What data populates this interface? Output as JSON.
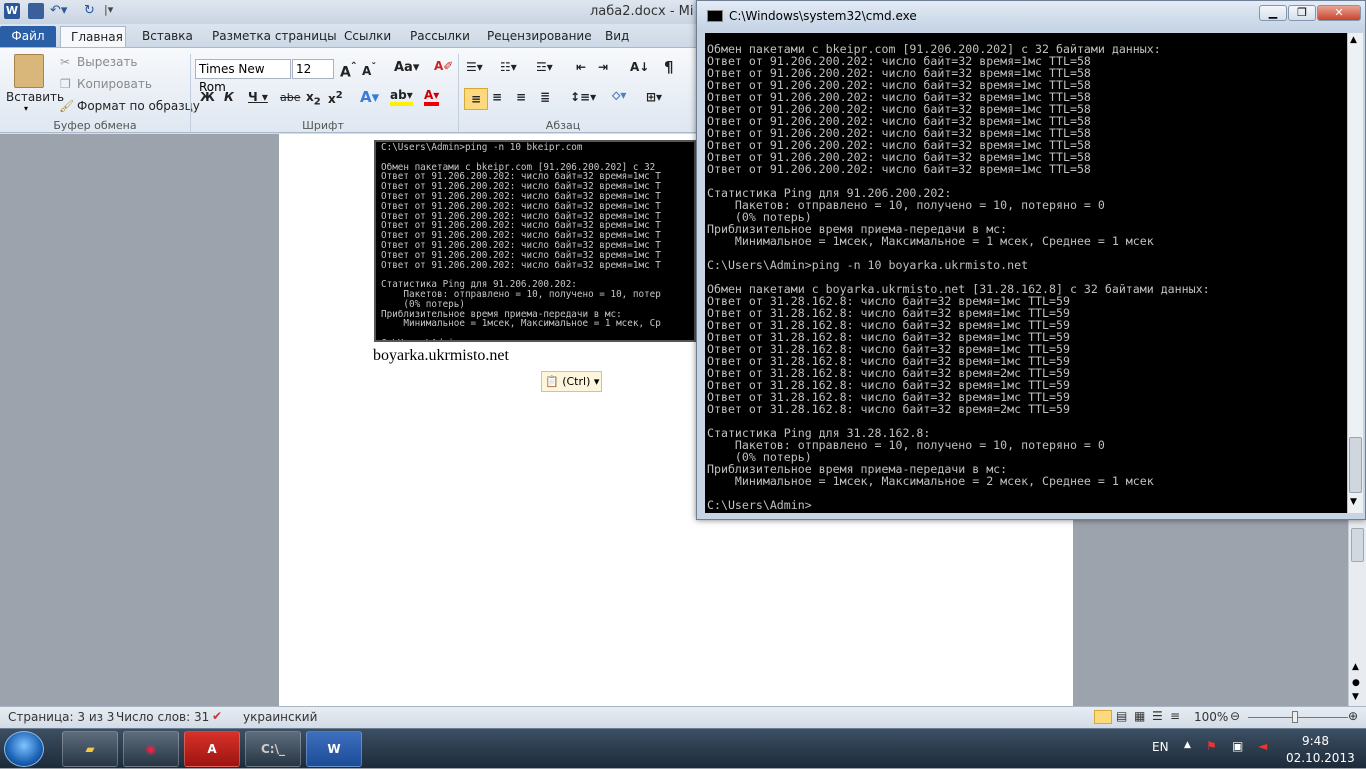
{
  "word": {
    "title": "лаба2.docx - Mi",
    "tabs": [
      "Файл",
      "Главная",
      "Вставка",
      "Разметка страницы",
      "Ссылки",
      "Рассылки",
      "Рецензирование",
      "Вид"
    ],
    "clipboard": {
      "paste": "Вставить",
      "cut": "Вырезать",
      "copy": "Копировать",
      "format": "Формат по образцу",
      "group": "Буфер обмена"
    },
    "font": {
      "name": "Times New Rom",
      "size": "12",
      "group": "Шрифт"
    },
    "paragraph": {
      "group": "Абзац"
    },
    "doc_text": "boyarka.ukrmisto.net",
    "paste_options": "(Ctrl)",
    "embedded_console": [
      "C:\\Users\\Admin>ping -n 10 bkeipr.com",
      "",
      "Обмен пакетами с bkeipr.com [91.206.200.202] с 32",
      "Ответ от 91.206.200.202: число байт=32 время=1мс T",
      "Ответ от 91.206.200.202: число байт=32 время=1мс T",
      "Ответ от 91.206.200.202: число байт=32 время=1мс T",
      "Ответ от 91.206.200.202: число байт=32 время=1мс T",
      "Ответ от 91.206.200.202: число байт=32 время=1мс T",
      "Ответ от 91.206.200.202: число байт=32 время=1мс T",
      "Ответ от 91.206.200.202: число байт=32 время=1мс T",
      "Ответ от 91.206.200.202: число байт=32 время=1мс T",
      "Ответ от 91.206.200.202: число байт=32 время=1мс T",
      "Ответ от 91.206.200.202: число байт=32 время=1мс T",
      "",
      "Статистика Ping для 91.206.200.202:",
      "    Пакетов: отправлено = 10, получено = 10, потер",
      "    (0% потерь)",
      "Приблизительное время приема-передачи в мс:",
      "    Минимальное = 1мсек, Максимальное = 1 мсек, Ср",
      "",
      "C:\\Users\\Admin>"
    ],
    "status": {
      "page": "Страница: 3 из 3",
      "words": "Число слов: 31",
      "lang": "украинский",
      "zoom": "100%"
    }
  },
  "cmd": {
    "title": "C:\\Windows\\system32\\cmd.exe",
    "lines": [
      "Обмен пакетами с bkeipr.com [91.206.200.202] с 32 байтами данных:",
      "Ответ от 91.206.200.202: число байт=32 время=1мс TTL=58",
      "Ответ от 91.206.200.202: число байт=32 время=1мс TTL=58",
      "Ответ от 91.206.200.202: число байт=32 время=1мс TTL=58",
      "Ответ от 91.206.200.202: число байт=32 время=1мс TTL=58",
      "Ответ от 91.206.200.202: число байт=32 время=1мс TTL=58",
      "Ответ от 91.206.200.202: число байт=32 время=1мс TTL=58",
      "Ответ от 91.206.200.202: число байт=32 время=1мс TTL=58",
      "Ответ от 91.206.200.202: число байт=32 время=1мс TTL=58",
      "Ответ от 91.206.200.202: число байт=32 время=1мс TTL=58",
      "Ответ от 91.206.200.202: число байт=32 время=1мс TTL=58",
      "",
      "Статистика Ping для 91.206.200.202:",
      "    Пакетов: отправлено = 10, получено = 10, потеряно = 0",
      "    (0% потерь)",
      "Приблизительное время приема-передачи в мс:",
      "    Минимальное = 1мсек, Максимальное = 1 мсек, Среднее = 1 мсек",
      "",
      "C:\\Users\\Admin>ping -n 10 boyarka.ukrmisto.net",
      "",
      "Обмен пакетами с boyarka.ukrmisto.net [31.28.162.8] с 32 байтами данных:",
      "Ответ от 31.28.162.8: число байт=32 время=1мс TTL=59",
      "Ответ от 31.28.162.8: число байт=32 время=1мс TTL=59",
      "Ответ от 31.28.162.8: число байт=32 время=1мс TTL=59",
      "Ответ от 31.28.162.8: число байт=32 время=1мс TTL=59",
      "Ответ от 31.28.162.8: число байт=32 время=1мс TTL=59",
      "Ответ от 31.28.162.8: число байт=32 время=1мс TTL=59",
      "Ответ от 31.28.162.8: число байт=32 время=2мс TTL=59",
      "Ответ от 31.28.162.8: число байт=32 время=1мс TTL=59",
      "Ответ от 31.28.162.8: число байт=32 время=1мс TTL=59",
      "Ответ от 31.28.162.8: число байт=32 время=2мс TTL=59",
      "",
      "Статистика Ping для 31.28.162.8:",
      "    Пакетов: отправлено = 10, получено = 10, потеряно = 0",
      "    (0% потерь)",
      "Приблизительное время приема-передачи в мс:",
      "    Минимальное = 1мсек, Максимальное = 2 мсек, Среднее = 1 мсек",
      "",
      "C:\\Users\\Admin>"
    ]
  },
  "taskbar": {
    "lang": "EN",
    "time": "9:48",
    "date": "02.10.2013"
  }
}
